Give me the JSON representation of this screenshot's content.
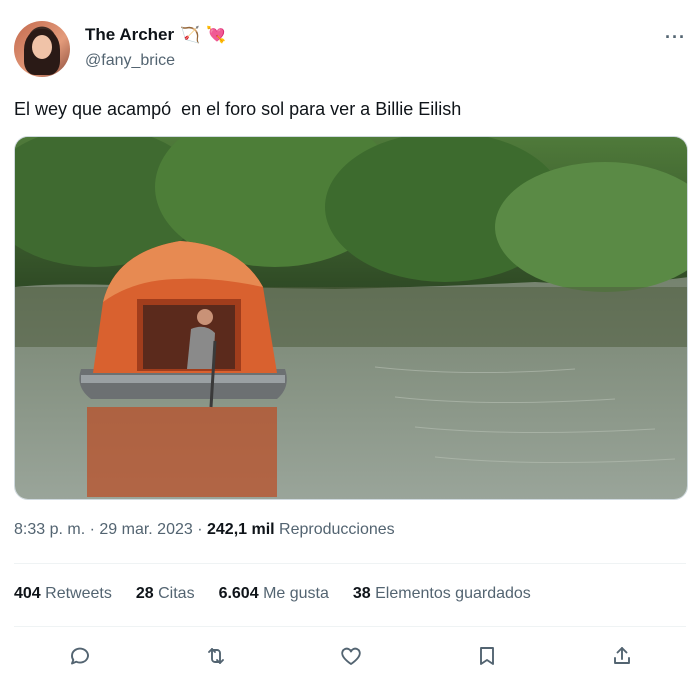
{
  "author": {
    "display_name": "The Archer",
    "handle": "@fany_brice",
    "emoji_bow": "🏹",
    "emoji_heart": "💘"
  },
  "more_icon": "more-horizontal-icon",
  "tweet": {
    "text": "El wey que acampó  en el foro sol para ver a Billie Eilish"
  },
  "meta": {
    "time": "8:33 p. m.",
    "sep1": " · ",
    "date": "29 mar. 2023",
    "sep2": " · ",
    "views_count": "242,1 mil",
    "views_label": " Reproducciones"
  },
  "stats": {
    "retweets": {
      "num": "404",
      "label": "Retweets"
    },
    "quotes": {
      "num": "28",
      "label": "Citas"
    },
    "likes": {
      "num": "6.604",
      "label": "Me gusta"
    },
    "bookmarks": {
      "num": "38",
      "label": "Elementos guardados"
    }
  },
  "actions": [
    "reply-icon",
    "retweet-icon",
    "like-icon",
    "bookmark-icon",
    "share-icon"
  ],
  "colors": {
    "text_primary": "#0f1419",
    "text_secondary": "#536471",
    "divider": "#eff3f4"
  }
}
